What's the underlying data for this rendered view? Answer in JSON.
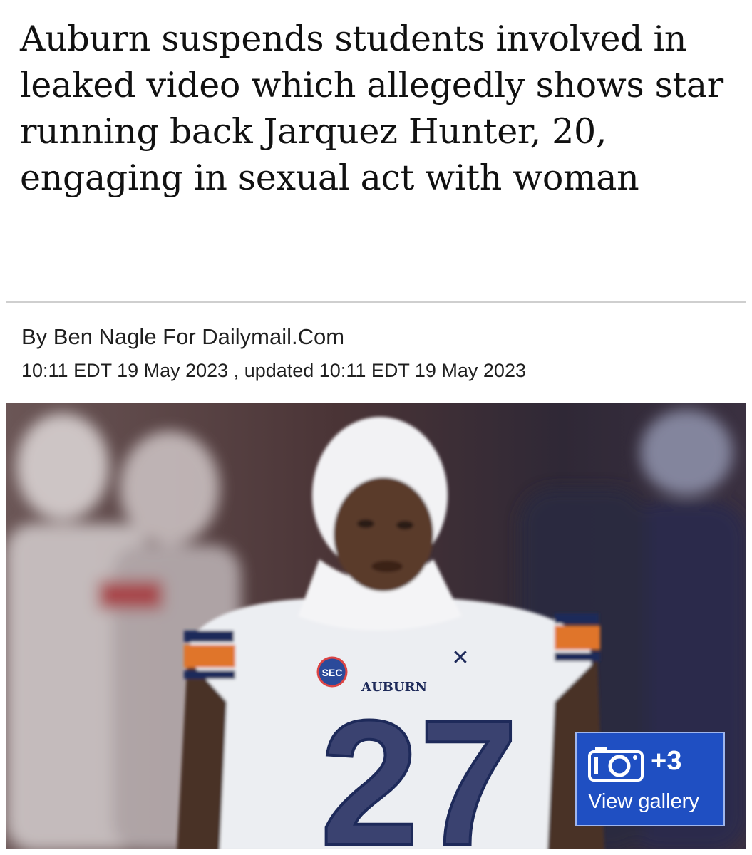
{
  "article": {
    "headline": "Auburn suspends students involved in leaked video which allegedly shows star running back Jarquez Hunter, 20, engaging in sexual act with woman",
    "byline": "By Ben Nagle For Dailymail.Com",
    "dates": "10:11 EDT 19 May 2023 , updated 10:11 EDT 19 May 2023"
  },
  "photo": {
    "jersey_number": "27",
    "jersey_text": "AUBURN",
    "conference_logo": "SEC"
  },
  "gallery": {
    "count": "+3",
    "label": "View gallery",
    "icon": "camera-icon"
  },
  "colors": {
    "gallery_bg": "#1f4fc2",
    "headline": "#111111"
  }
}
